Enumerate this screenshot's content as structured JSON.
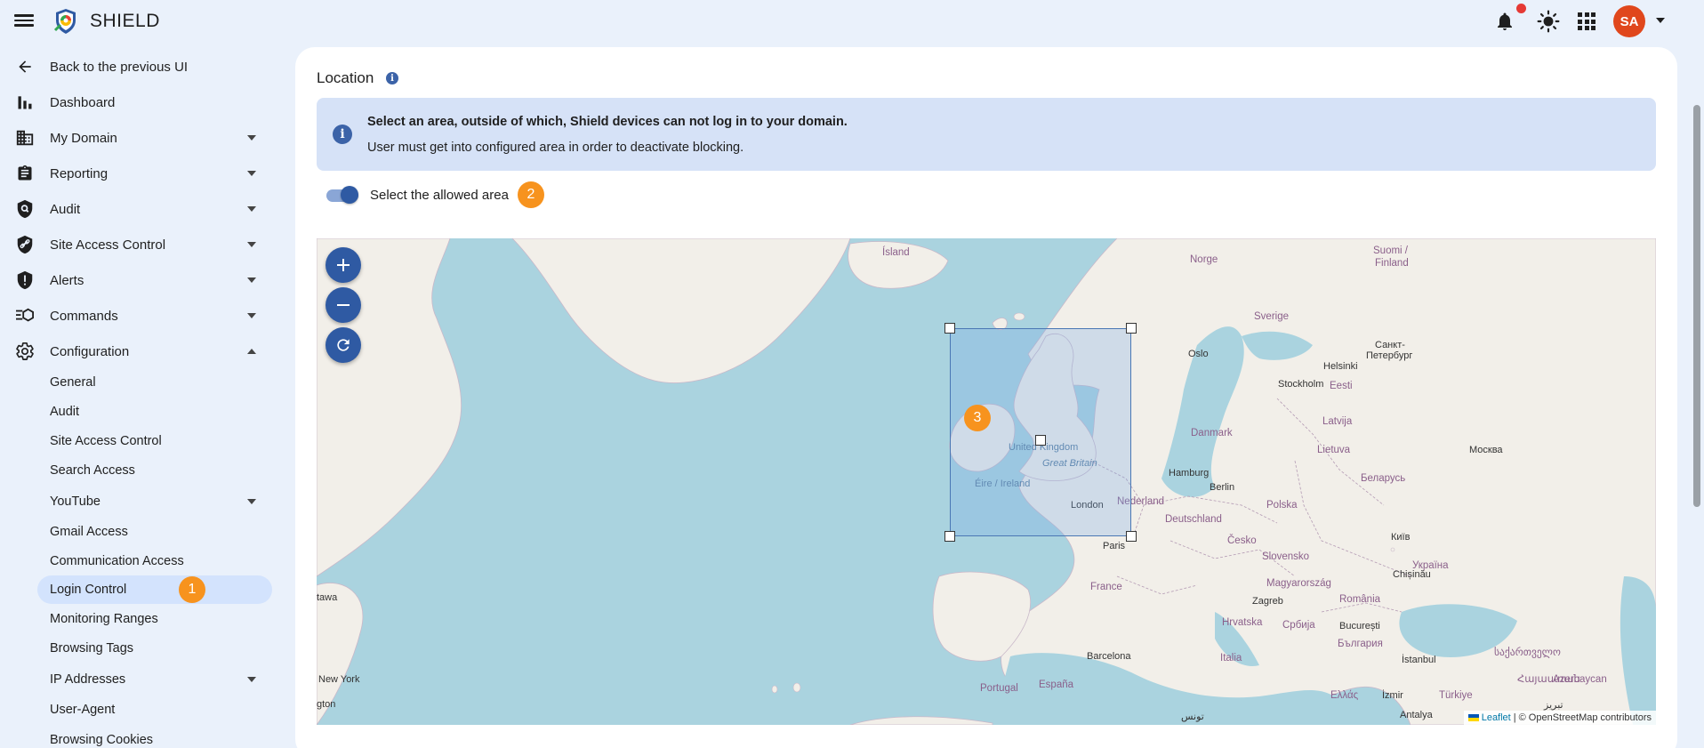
{
  "app": {
    "brand": "SHIELD",
    "user_initials": "SA"
  },
  "sidebar": {
    "items": [
      {
        "label": "Back to the previous UI",
        "icon": "arrow-left-icon"
      },
      {
        "label": "Dashboard",
        "icon": "bar-chart-icon"
      },
      {
        "label": "My Domain",
        "icon": "building-icon"
      },
      {
        "label": "Reporting",
        "icon": "clipboard-icon"
      },
      {
        "label": "Audit",
        "icon": "audit-shield-icon"
      },
      {
        "label": "Site Access Control",
        "icon": "link-shield-icon"
      },
      {
        "label": "Alerts",
        "icon": "alert-shield-icon"
      },
      {
        "label": "Commands",
        "icon": "commands-icon"
      },
      {
        "label": "Configuration",
        "icon": "gear-icon"
      }
    ],
    "config_children": [
      {
        "label": "General"
      },
      {
        "label": "Audit"
      },
      {
        "label": "Site Access Control"
      },
      {
        "label": "Search Access"
      },
      {
        "label": "YouTube"
      },
      {
        "label": "Gmail Access"
      },
      {
        "label": "Communication Access"
      },
      {
        "label": "Login Control",
        "badge": "1"
      },
      {
        "label": "Monitoring Ranges"
      },
      {
        "label": "Browsing Tags"
      },
      {
        "label": "IP Addresses"
      },
      {
        "label": "User-Agent"
      },
      {
        "label": "Browsing Cookies"
      }
    ]
  },
  "main": {
    "title": "Location",
    "info_line1": "Select an area, outside of which, Shield devices can not log in to your domain.",
    "info_line2": "User must get into configured area in order to deactivate blocking.",
    "toggle_label": "Select the allowed area",
    "toggle_badge": "2",
    "map_badge": "3",
    "toggle_on": true
  },
  "map": {
    "labels": {
      "island": "Ísland",
      "norge": "Norge",
      "suomi": "Suomi /",
      "finland": "Finland",
      "sverige": "Sverige",
      "oslo": "Oslo",
      "stockholm": "Stockholm",
      "helsinki": "Helsinki",
      "spb1": "Санкт-",
      "spb2": "Петербург",
      "eesti": "Eesti",
      "latvija": "Latvija",
      "lietuva": "Lietuva",
      "moskva": "Москва",
      "danmark": "Danmark",
      "uk": "United Kingdom",
      "gb": "Great Britain",
      "eire": "Éire / Ireland",
      "london": "London",
      "nederland": "Nederland",
      "hamburg": "Hamburg",
      "berlin": "Berlin",
      "polska": "Polska",
      "belarus": "Беларусь",
      "deutschland": "Deutschland",
      "kyiv": "Київ",
      "paris": "Paris",
      "cesko": "Česko",
      "slovensko": "Slovensko",
      "ukraina": "Україна",
      "chisinau": "Chișinău",
      "france": "France",
      "magyarorszag": "Magyarország",
      "zagreb": "Zagreb",
      "romania": "România",
      "hrvatska": "Hrvatska",
      "srbija": "Србија",
      "bucuresti": "București",
      "bulgaria": "България",
      "barcelona": "Barcelona",
      "italia": "Italia",
      "istanbul": "İstanbul",
      "georgia": "საქართველო",
      "portugal": "Portugal",
      "espana": "España",
      "ellas": "Ελλάς",
      "izmir": "İzmir",
      "turkiye": "Türkiye",
      "armenia": "Հայաստան",
      "azerbaycan": "Azerbaycan",
      "antalya": "Antalya",
      "tabriz": "تبریز",
      "tunis": "تونس",
      "tawa": "tawa",
      "newyork": "New York",
      "gton": "gton"
    },
    "attribution_leaflet": "Leaflet",
    "attribution_rest": "| © OpenStreetMap contributors",
    "colors": {
      "water": "#aad3df",
      "land": "#f2efe9",
      "selection": "#4a77b4"
    }
  },
  "colors": {
    "accent": "#2f5aa3",
    "badge": "#f7931e",
    "avatar": "#e0471c",
    "active_bg": "#d3e3fd"
  }
}
